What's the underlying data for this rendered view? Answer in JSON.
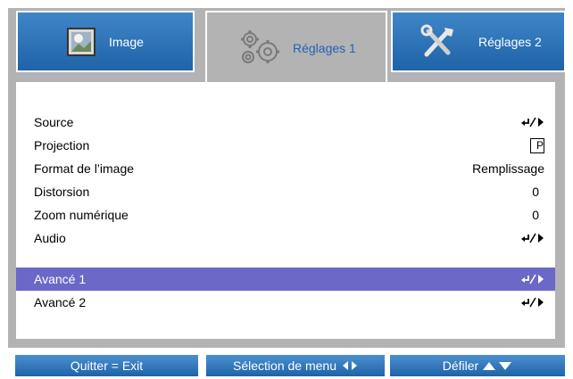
{
  "tabs": [
    {
      "label": "Image",
      "icon": "image-icon",
      "active": false
    },
    {
      "label": "Réglages 1",
      "icon": "gears-icon",
      "active": true
    },
    {
      "label": "Réglages 2",
      "icon": "tools-icon",
      "active": false
    }
  ],
  "menu": [
    {
      "label": "Source",
      "value_type": "enter-arrow"
    },
    {
      "label": "Projection",
      "value_type": "p-box",
      "value": "P"
    },
    {
      "label": "Format de l’image",
      "value": "Remplissage"
    },
    {
      "label": "Distorsion",
      "value": "0"
    },
    {
      "label": "Zoom numérique",
      "value": "0"
    },
    {
      "label": "Audio",
      "value_type": "enter-arrow"
    },
    {
      "label": "Avancé 1",
      "value_type": "enter-arrow",
      "selected": true
    },
    {
      "label": "Avancé 2",
      "value_type": "enter-arrow"
    }
  ],
  "footer": {
    "quit": "Quitter = Exit",
    "select": "Sélection de menu",
    "scroll": "Défiler"
  },
  "colors": {
    "tab_blue": "#1f63a8",
    "active_text": "#1e63b8",
    "selected_row": "#6b68c8",
    "frame_gray": "#b3b3b3"
  }
}
